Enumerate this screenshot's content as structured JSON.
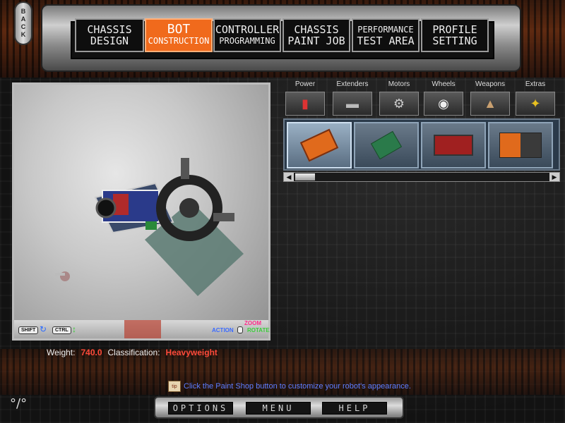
{
  "back_button": {
    "label": "BACK"
  },
  "nav_tabs": [
    {
      "line1": "CHASSIS",
      "line2": "DESIGN",
      "active": false
    },
    {
      "line1": "BOT",
      "line2": "CONSTRUCTION",
      "active": true
    },
    {
      "line1": "CONTROLLER",
      "line2": "PROGRAMMING",
      "active": false
    },
    {
      "line1": "CHASSIS",
      "line2": "PAINT JOB",
      "active": false
    },
    {
      "line1": "PERFORMANCE",
      "line2": "TEST AREA",
      "active": false
    },
    {
      "line1": "PROFILE",
      "line2": "SETTING",
      "active": false
    }
  ],
  "viewport_controls": {
    "shift_key": "SHIFT",
    "ctrl_key": "CTRL",
    "zoom_label": "ZOOM",
    "action_label": "ACTION",
    "rotate_label": "ROTATE"
  },
  "stats": {
    "weight_label": "Weight:",
    "weight_value": "740.0",
    "classification_label": "Classification:",
    "classification_value": "Heavyweight"
  },
  "part_categories": [
    {
      "label": "Power",
      "icon": "battery-icon"
    },
    {
      "label": "Extenders",
      "icon": "extender-bar-icon"
    },
    {
      "label": "Motors",
      "icon": "motor-icon"
    },
    {
      "label": "Wheels",
      "icon": "wheel-icon"
    },
    {
      "label": "Weapons",
      "icon": "weapon-icon"
    },
    {
      "label": "Extras",
      "icon": "extras-icon"
    }
  ],
  "parts": [
    {
      "name": "orange-battery-pack",
      "selected": true
    },
    {
      "name": "green-circuit-board",
      "selected": false
    },
    {
      "name": "red-battery-block",
      "selected": false
    },
    {
      "name": "battery-cells",
      "selected": false
    }
  ],
  "tip": {
    "text": "Click the Paint Shop button to customize your robot's appearance."
  },
  "bottom_buttons": [
    "OPTIONS",
    "MENU",
    "HELP"
  ],
  "colors": {
    "accent_orange": "#f06a1c",
    "value_red": "#ff4a3a",
    "tip_blue": "#5f7dff",
    "zoom_magenta": "#ff2a8a",
    "rotate_green": "#3acc3a",
    "action_blue": "#3a6aff"
  }
}
